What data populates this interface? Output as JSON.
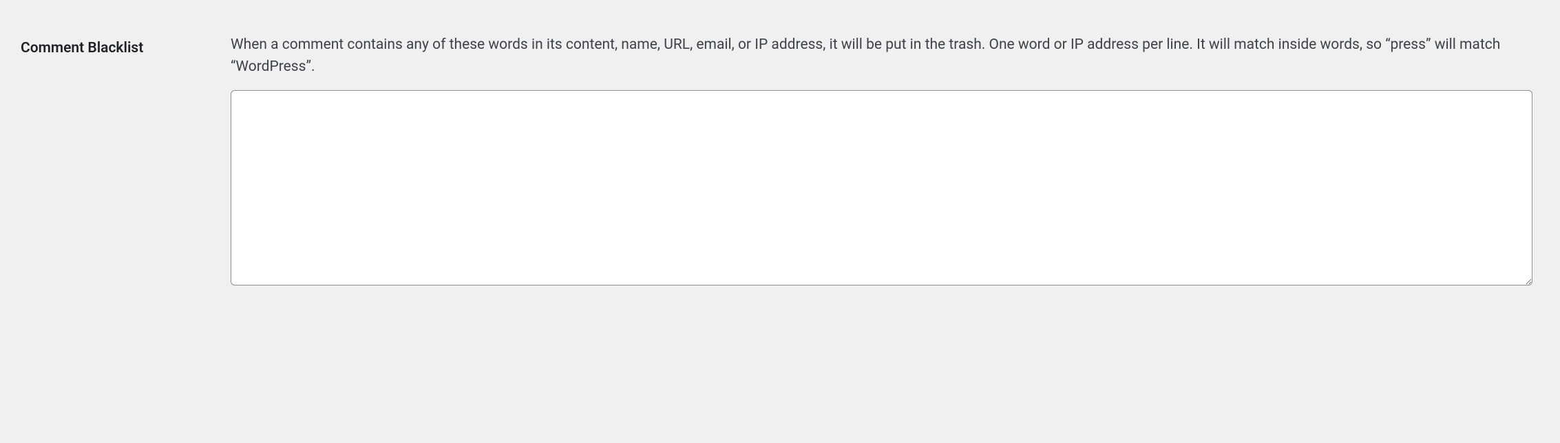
{
  "settings": {
    "comment_blacklist": {
      "label": "Comment Blacklist",
      "description": "When a comment contains any of these words in its content, name, URL, email, or IP address, it will be put in the trash. One word or IP address per line. It will match inside words, so “press” will match “WordPress”.",
      "value": ""
    }
  }
}
